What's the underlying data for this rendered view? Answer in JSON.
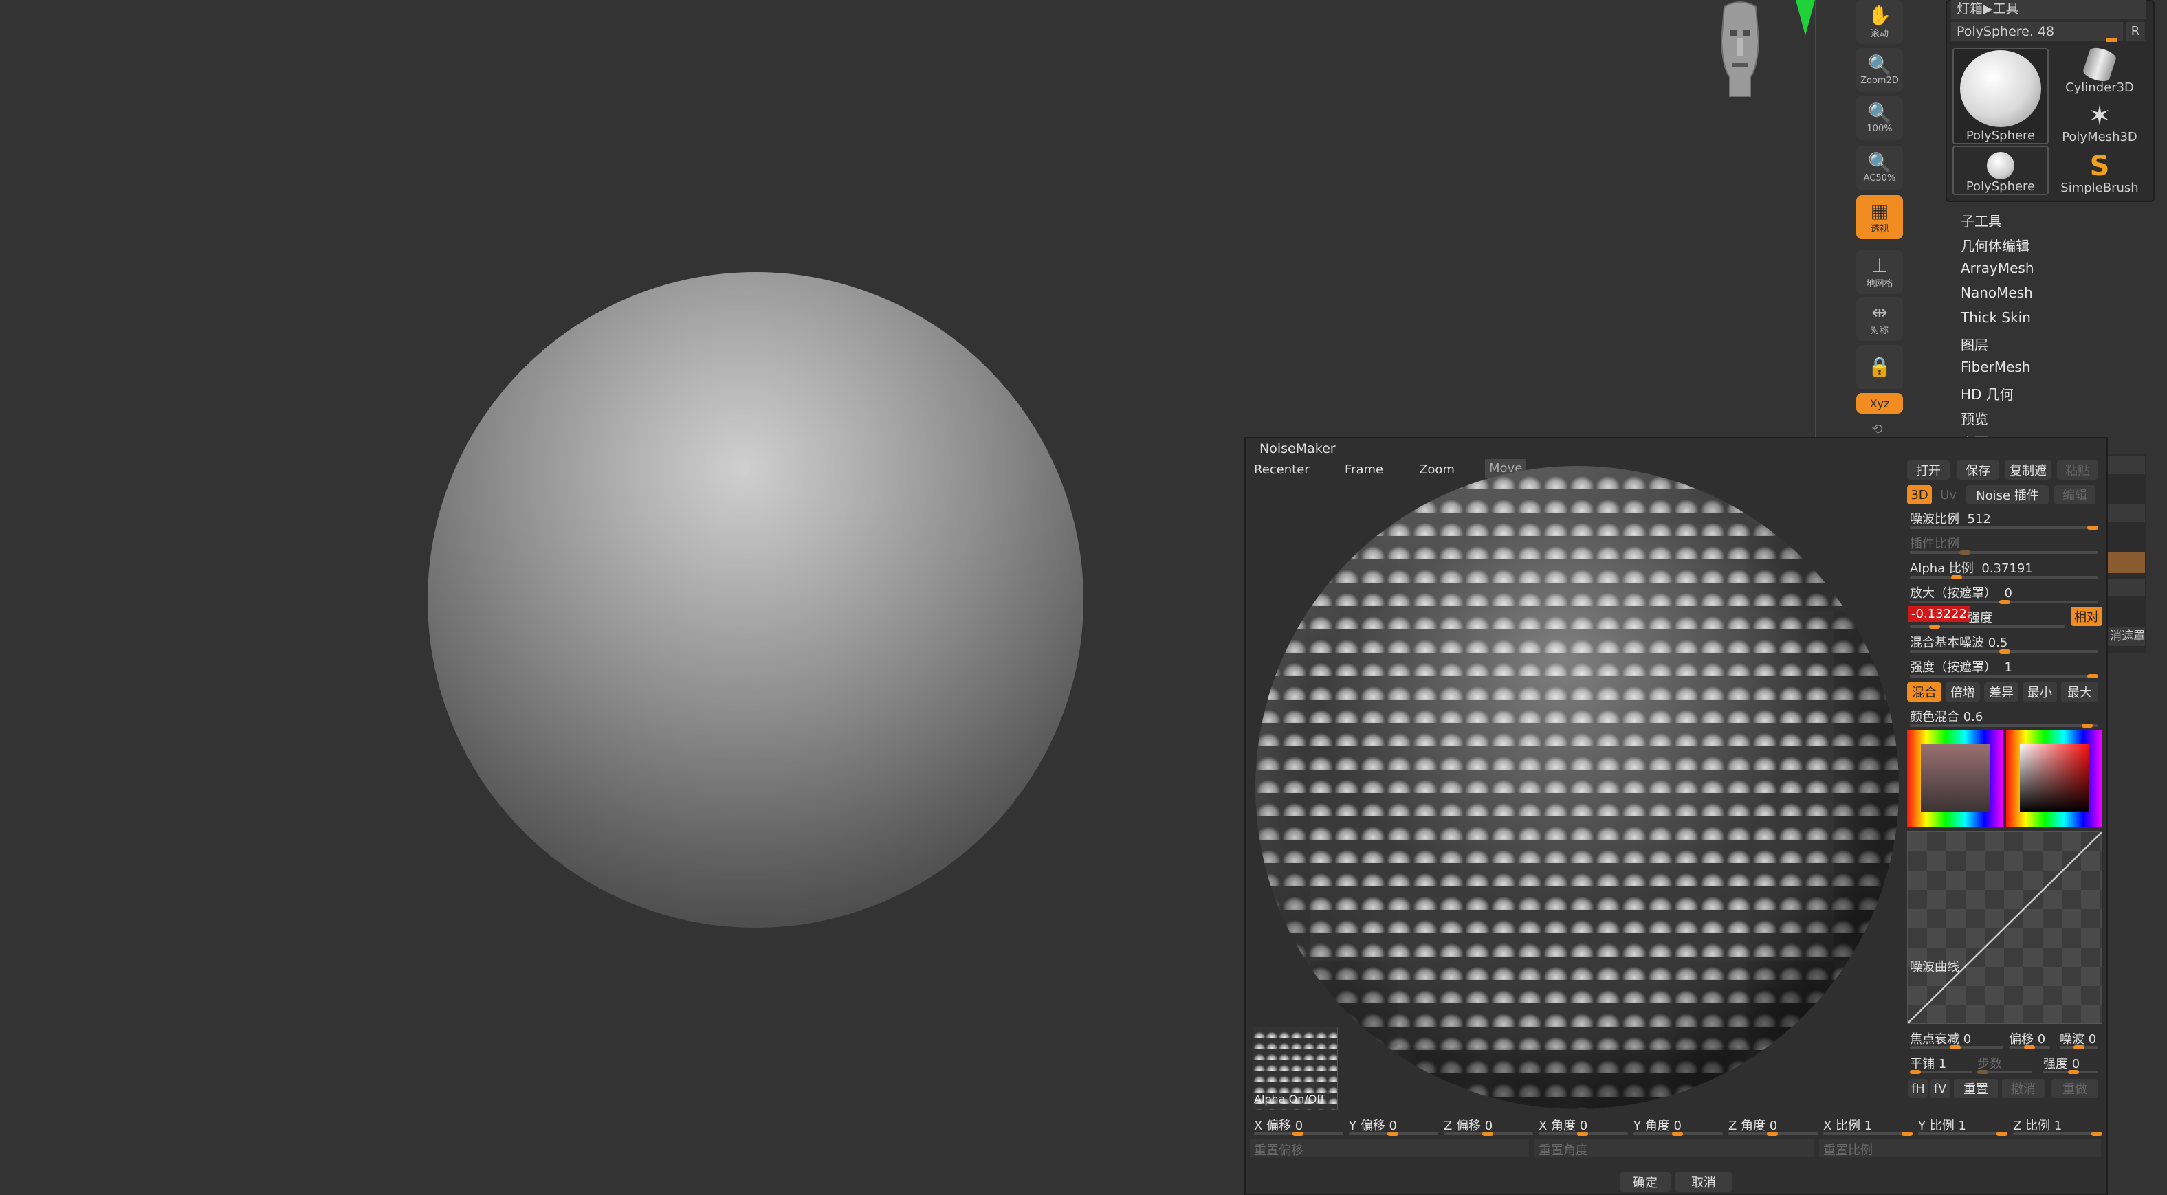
{
  "canvas": {
    "colors": {
      "background": "#333333",
      "accent": "#f08c20"
    }
  },
  "toolbar": {
    "items": [
      {
        "label": "滚动",
        "icon": "hand-icon"
      },
      {
        "label": "Zoom2D",
        "icon": "zoom-icon"
      },
      {
        "label": "100%",
        "icon": "zoom-icon"
      },
      {
        "label": "AC50%",
        "icon": "zoom-icon"
      },
      {
        "label": "透视",
        "icon": "perspective-icon"
      },
      {
        "label": "地网格",
        "icon": "floor-grid-icon"
      },
      {
        "label": "对称",
        "icon": "symmetry-icon"
      },
      {
        "label": "",
        "icon": "lock-icon"
      },
      {
        "label": "Xyz",
        "icon": "xyz-axis-icon"
      }
    ]
  },
  "tool_panel": {
    "header": "灯箱▶工具",
    "current_tool": "PolySphere. 48",
    "r_button": "R",
    "thumbnails": [
      {
        "label": "PolySphere"
      },
      {
        "label": "Cylinder3D"
      },
      {
        "label": "PolyMesh3D"
      },
      {
        "label": "PolySphere"
      },
      {
        "label": "SimpleBrush"
      }
    ],
    "menu": [
      "子工具",
      "几何体编辑",
      "ArrayMesh",
      "NanoMesh",
      "Thick Skin",
      "图层",
      "FiberMesh",
      "HD 几何",
      "预览",
      "表面"
    ],
    "partial_right": [
      "消遮罩"
    ]
  },
  "noisemaker": {
    "title": "NoiseMaker",
    "view_buttons": [
      "Recenter",
      "Frame",
      "Zoom",
      "Move"
    ],
    "top_buttons": {
      "open": "打开",
      "save": "保存",
      "copy": "复制遮",
      "paste": "粘贴"
    },
    "mode": {
      "3d": "3D",
      "uv": "Uv",
      "plugin": "Noise 插件",
      "edit": "编辑"
    },
    "params": {
      "noise_scale_label": "噪波比例",
      "noise_scale": "512",
      "plugin_scale_label": "插件比例",
      "alpha_scale_label": "Alpha 比例",
      "alpha_scale": "0.37191",
      "magnify_label": "放大（按遮罩）",
      "magnify": "0",
      "strength_value": "-0.13222",
      "strength_label": "强度",
      "relative": "相对",
      "blend_base_label": "混合基本噪波",
      "blend_base": "0.5",
      "strength_mask_label": "强度（按遮罩）",
      "strength_mask": "1"
    },
    "blend_modes": [
      "混合",
      "倍增",
      "差异",
      "最小",
      "最大"
    ],
    "color_blend_label": "颜色混合",
    "color_blend": "0.6",
    "curve_label": "噪波曲线",
    "focal": {
      "label": "焦点衰减",
      "value": "0"
    },
    "offset": {
      "label": "偏移",
      "value": "0"
    },
    "noise": {
      "label": "噪波",
      "value": "0"
    },
    "tile": {
      "label": "平铺",
      "value": "1"
    },
    "steps": {
      "label": "步数"
    },
    "strength2": {
      "label": "强度",
      "value": "0"
    },
    "bottom_small": {
      "fh": "fH",
      "fv": "fV",
      "reset": "重置",
      "undo": "撤消",
      "redo": "重做"
    },
    "alpha_onoff": "Alpha On/Off",
    "transforms": [
      {
        "label": "X 偏移",
        "value": "0"
      },
      {
        "label": "Y 偏移",
        "value": "0"
      },
      {
        "label": "Z 偏移",
        "value": "0"
      },
      {
        "label": "X 角度",
        "value": "0"
      },
      {
        "label": "Y 角度",
        "value": "0"
      },
      {
        "label": "Z 角度",
        "value": "0"
      },
      {
        "label": "X 比例",
        "value": "1"
      },
      {
        "label": "Y 比例",
        "value": "1"
      },
      {
        "label": "Z 比例",
        "value": "1"
      }
    ],
    "reset_offset": "重置偏移",
    "reset_angle": "重置角度",
    "reset_scale": "重置比例",
    "ok": "确定",
    "cancel": "取消"
  }
}
